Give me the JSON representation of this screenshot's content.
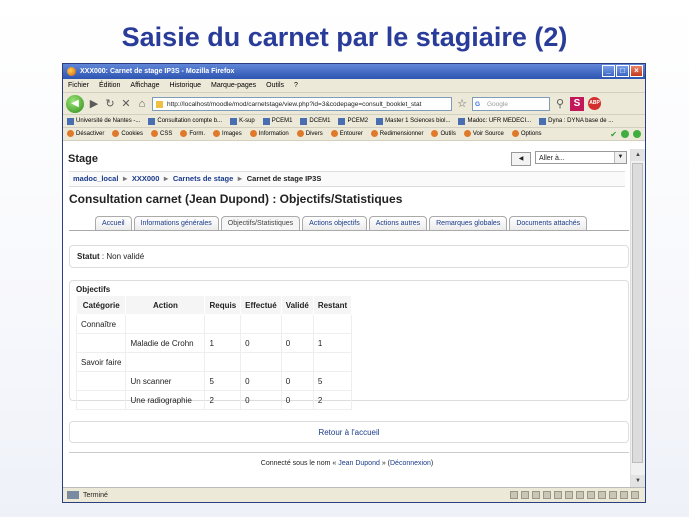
{
  "slide": {
    "title": "Saisie du carnet par le stagiaire (2)"
  },
  "browser": {
    "window_title": "XXX000: Carnet de stage IP3S - Mozilla Firefox",
    "menu": [
      "Fichier",
      "Édition",
      "Affichage",
      "Historique",
      "Marque-pages",
      "Outils",
      "?"
    ],
    "url": "http://localhost/moodle/mod/carnetstage/view.php?id=3&codepage=consult_booklet_stat",
    "search_placeholder": "Google",
    "bookmarks": [
      "Université de Nantes -...",
      "Consultation compte b...",
      "K-sup",
      "PCEM1",
      "DCEM1",
      "PCEM2",
      "Master 1 Sciences biol...",
      "Madoc: UFR MEDECI...",
      "Dyna : DYNA base de ..."
    ],
    "devtools": [
      "Désactiver",
      "Cookies",
      "CSS",
      "Form.",
      "Images",
      "Information",
      "Divers",
      "Entourer",
      "Redimensionner",
      "Outils",
      "Voir Source",
      "Options"
    ],
    "status": "Terminé"
  },
  "page": {
    "heading": "Stage",
    "jump_label": "Aller à...",
    "breadcrumb": [
      "madoc_local",
      "XXX000",
      "Carnets de stage",
      "Carnet de stage IP3S"
    ],
    "title": "Consultation carnet (Jean Dupond) : Objectifs/Statistiques",
    "tabs": [
      "Accueil",
      "Informations générales",
      "Objectifs/Statistiques",
      "Actions objectifs",
      "Actions autres",
      "Remarques globales",
      "Documents attachés"
    ],
    "status_label": "Statut",
    "status_value": "Non validé",
    "objectives_title": "Objectifs",
    "table": {
      "headers": [
        "Catégorie",
        "Action",
        "Requis",
        "Effectué",
        "Validé",
        "Restant"
      ],
      "rows": [
        [
          "Connaître",
          "",
          "",
          "",
          "",
          ""
        ],
        [
          "",
          "Maladie de Crohn",
          "1",
          "0",
          "0",
          "1"
        ],
        [
          "Savoir faire",
          "",
          "",
          "",
          "",
          ""
        ],
        [
          "",
          "Un scanner",
          "5",
          "0",
          "0",
          "5"
        ],
        [
          "",
          "Une radiographie",
          "2",
          "0",
          "0",
          "2"
        ]
      ]
    },
    "return_link": "Retour à l'accueil",
    "login_prefix": "Connecté sous le nom «",
    "login_user": "Jean Dupond",
    "login_mid": "» (",
    "logout": "Déconnexion",
    "login_suffix": ")"
  }
}
